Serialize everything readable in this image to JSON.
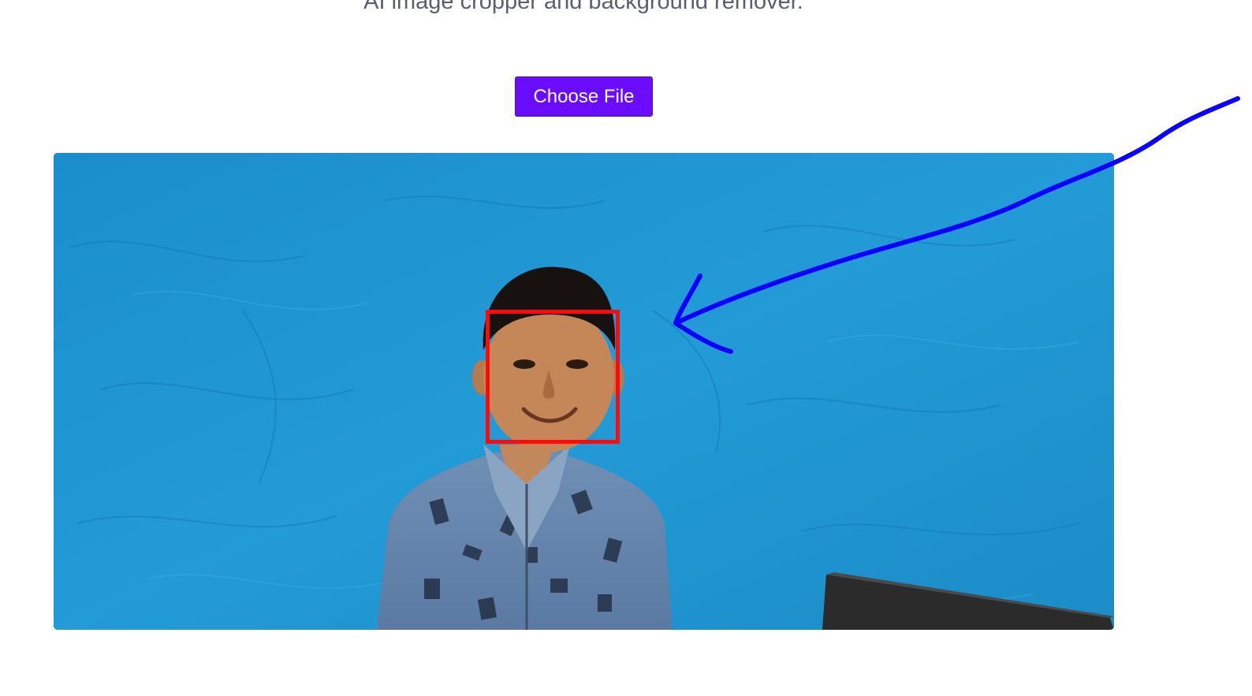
{
  "header": {
    "subtitle": "AI image cropper and background remover."
  },
  "upload": {
    "button_label": "Choose File"
  },
  "preview": {
    "image_alt": "Uploaded portrait photo of a boy against a blue backdrop",
    "face_box_label": "Detected face"
  },
  "colors": {
    "button_bg": "#6a0dff",
    "face_box": "#ff0a0a",
    "annotation_arrow": "#0a00ff",
    "backdrop": "#1f93cf"
  },
  "icons": {
    "annotation": "arrow-pointer-icon"
  }
}
